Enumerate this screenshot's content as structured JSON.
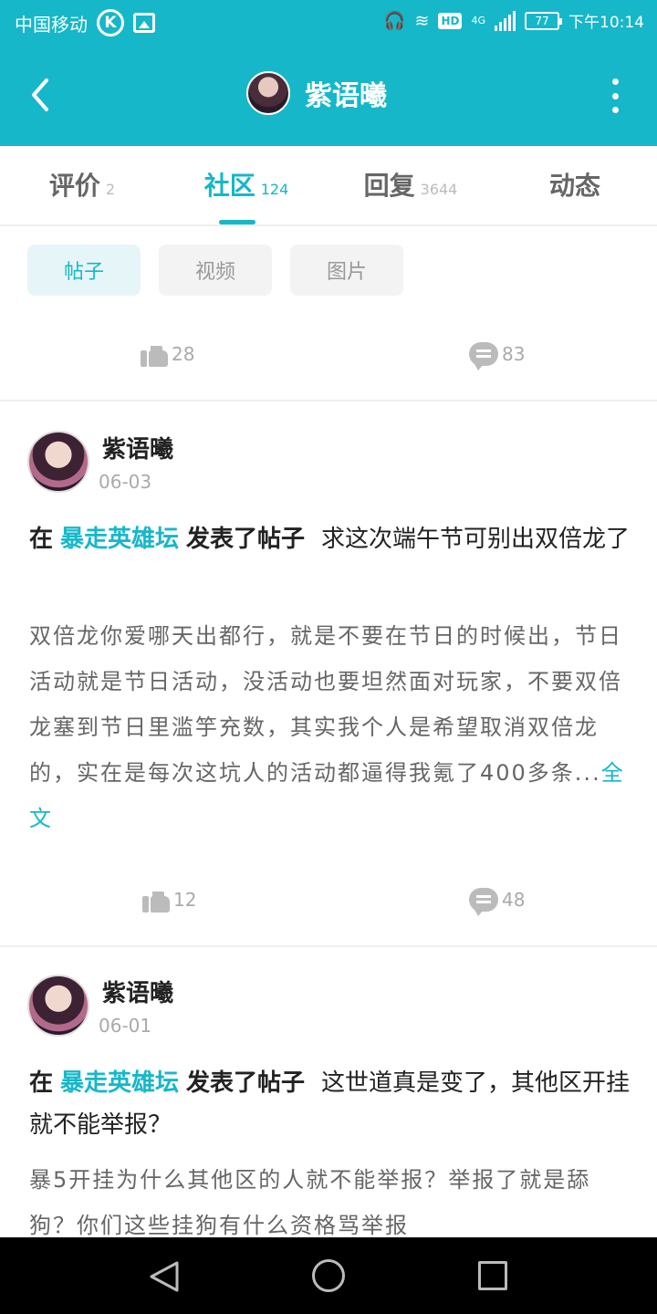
{
  "status_bar": {
    "carrier": "中国移动",
    "k_icon": "K",
    "hd": "HD",
    "network": "4G",
    "battery": "77",
    "time": "下午10:14"
  },
  "header": {
    "title": "紫语曦",
    "back_icon": "chevron-left-icon",
    "more_icon": "more-vertical-icon"
  },
  "tabs": [
    {
      "label": "评价",
      "count": "2"
    },
    {
      "label": "社区",
      "count": "124"
    },
    {
      "label": "回复",
      "count": "3644"
    },
    {
      "label": "动态",
      "count": ""
    }
  ],
  "active_tab": 1,
  "filters": [
    {
      "label": "帖子"
    },
    {
      "label": "视频"
    },
    {
      "label": "图片"
    }
  ],
  "top_stats": {
    "likes": "28",
    "comments": "83"
  },
  "posts": [
    {
      "author": "紫语曦",
      "date": "06-03",
      "prefix": "在",
      "forum": "暴走英雄坛",
      "action": "发表了帖子",
      "title": "求这次端午节可别出双倍龙了",
      "body": "双倍龙你爱哪天出都行，就是不要在节日的时候出，节日活动就是节日活动，没活动也要坦然面对玩家，不要双倍龙塞到节日里滥竽充数，其实我个人是希望取消双倍龙的，实在是每次这坑人的活动都逼得我氪了400多条...",
      "more": "全文",
      "likes": "12",
      "comments": "48"
    },
    {
      "author": "紫语曦",
      "date": "06-01",
      "prefix": "在",
      "forum": "暴走英雄坛",
      "action": "发表了帖子",
      "title": "这世道真是变了，其他区开挂就不能举报？",
      "body": "暴5开挂为什么其他区的人就不能举报？举报了就是舔狗？你们这些挂狗有什么资格骂举报"
    }
  ]
}
